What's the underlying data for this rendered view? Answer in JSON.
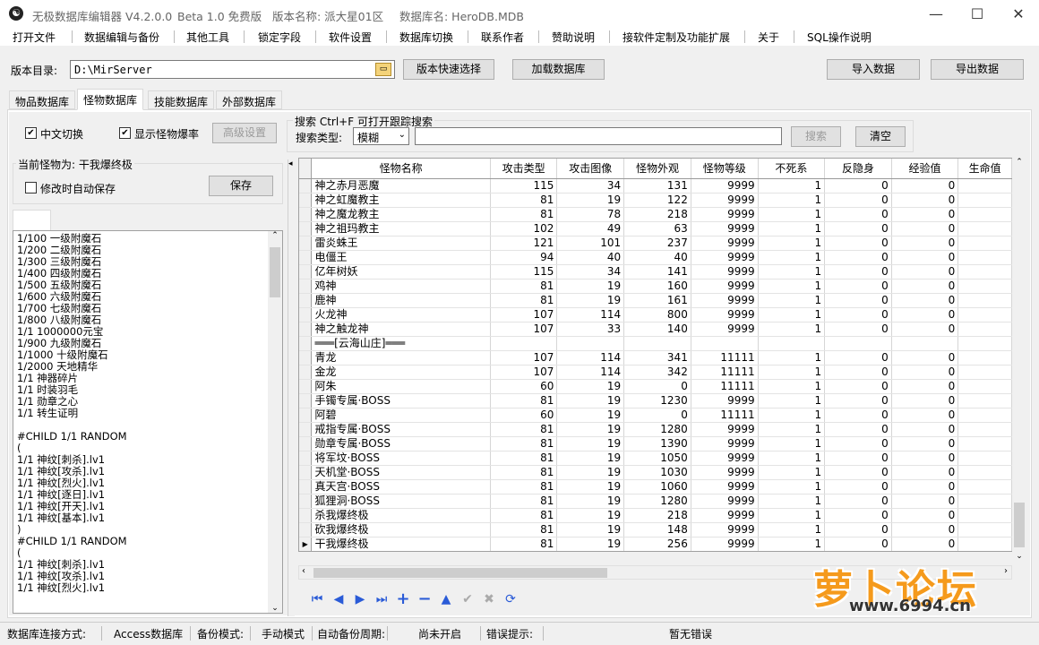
{
  "titlebar": {
    "app_name": "无极数据库编辑器 V4.2.0.0",
    "edition": "Beta 1.0 免费版",
    "version_name": "版本名称: 派大星01区",
    "db_name": "数据库名: HeroDB.MDB",
    "minimize": "—",
    "maximize": "☐",
    "close": "✕"
  },
  "menu": [
    "打开文件",
    "数据编辑与备份",
    "其他工具",
    "锁定字段",
    "软件设置",
    "数据库切换",
    "联系作者",
    "赞助说明",
    "接软件定制及功能扩展",
    "关于",
    "SQL操作说明"
  ],
  "toolbar": {
    "dir_label": "版本目录:",
    "dir_value": "D:\\MirServer",
    "quick_select": "版本快速选择",
    "load_db": "加载数据库",
    "import": "导入数据",
    "export": "导出数据"
  },
  "tabs": [
    "物品数据库",
    "怪物数据库",
    "技能数据库",
    "外部数据库"
  ],
  "options": {
    "chinese_switch": "中文切换",
    "show_drop": "显示怪物爆率",
    "advanced": "高级设置"
  },
  "search": {
    "legend": "搜索   Ctrl+F 可打开跟踪搜索",
    "type_label": "搜索类型:",
    "type_value": "模糊",
    "query": "",
    "search_btn": "搜索",
    "clear_btn": "清空"
  },
  "left_panel": {
    "current_label": "当前怪物为: 干我爆终极",
    "auto_save": "修改时自动保存",
    "save_btn": "保存",
    "drop_lines": [
      "1/100 一级附魔石",
      "1/200 二级附魔石",
      "1/300 三级附魔石",
      "1/400 四级附魔石",
      "1/500 五级附魔石",
      "1/600 六级附魔石",
      "1/700 七级附魔石",
      "1/800 八级附魔石",
      "1/1 1000000元宝",
      "1/900 九级附魔石",
      "1/1000 十级附魔石",
      "1/2000 天地精华",
      "1/1 神器碎片",
      "1/1 时装羽毛",
      "1/1 勋章之心",
      "1/1 转生证明",
      "",
      "#CHILD  1/1       RANDOM",
      "(",
      "1/1 神纹[刺杀].lv1",
      "1/1 神纹[攻杀].lv1",
      "1/1 神纹[烈火].lv1",
      "1/1 神纹[逐日].lv1",
      "1/1 神纹[开天].lv1",
      "1/1 神纹[基本].lv1",
      ")",
      "#CHILD  1/1       RANDOM",
      "(",
      "1/1 神纹[刺杀].lv1",
      "1/1 神纹[攻杀].lv1",
      "1/1 神纹[烈火].lv1"
    ]
  },
  "grid": {
    "columns": [
      "怪物名称",
      "攻击类型",
      "攻击图像",
      "怪物外观",
      "怪物等级",
      "不死系",
      "反隐身",
      "经验值",
      "生命值"
    ],
    "rows": [
      [
        "神之赤月恶魔",
        "115",
        "34",
        "131",
        "9999",
        "1",
        "0",
        "0"
      ],
      [
        "神之虹魔教主",
        "81",
        "19",
        "122",
        "9999",
        "1",
        "0",
        "0"
      ],
      [
        "神之魔龙教主",
        "81",
        "78",
        "218",
        "9999",
        "1",
        "0",
        "0"
      ],
      [
        "神之祖玛教主",
        "102",
        "49",
        "63",
        "9999",
        "1",
        "0",
        "0"
      ],
      [
        "雷炎蛛王",
        "121",
        "101",
        "237",
        "9999",
        "1",
        "0",
        "0"
      ],
      [
        "电僵王",
        "94",
        "40",
        "40",
        "9999",
        "1",
        "0",
        "0"
      ],
      [
        "亿年树妖",
        "115",
        "34",
        "141",
        "9999",
        "1",
        "0",
        "0"
      ],
      [
        "鸡神",
        "81",
        "19",
        "160",
        "9999",
        "1",
        "0",
        "0"
      ],
      [
        "鹿神",
        "81",
        "19",
        "161",
        "9999",
        "1",
        "0",
        "0"
      ],
      [
        "火龙神",
        "107",
        "114",
        "800",
        "9999",
        "1",
        "0",
        "0"
      ],
      [
        "神之触龙神",
        "107",
        "33",
        "140",
        "9999",
        "1",
        "0",
        "0"
      ],
      [
        "═══[云海山庄]═══",
        "",
        "",
        "",
        "",
        "",
        "",
        ""
      ],
      [
        "青龙",
        "107",
        "114",
        "341",
        "11111",
        "1",
        "0",
        "0"
      ],
      [
        "金龙",
        "107",
        "114",
        "342",
        "11111",
        "1",
        "0",
        "0"
      ],
      [
        "阿朱",
        "60",
        "19",
        "0",
        "11111",
        "1",
        "0",
        "0"
      ],
      [
        "手镯专属·BOSS",
        "81",
        "19",
        "1230",
        "9999",
        "1",
        "0",
        "0"
      ],
      [
        "阿碧",
        "60",
        "19",
        "0",
        "11111",
        "1",
        "0",
        "0"
      ],
      [
        "戒指专属·BOSS",
        "81",
        "19",
        "1280",
        "9999",
        "1",
        "0",
        "0"
      ],
      [
        "勋章专属·BOSS",
        "81",
        "19",
        "1390",
        "9999",
        "1",
        "0",
        "0"
      ],
      [
        "将军坟·BOSS",
        "81",
        "19",
        "1050",
        "9999",
        "1",
        "0",
        "0"
      ],
      [
        "天机堂·BOSS",
        "81",
        "19",
        "1030",
        "9999",
        "1",
        "0",
        "0"
      ],
      [
        "真天宫·BOSS",
        "81",
        "19",
        "1060",
        "9999",
        "1",
        "0",
        "0"
      ],
      [
        "狐狸洞·BOSS",
        "81",
        "19",
        "1280",
        "9999",
        "1",
        "0",
        "0"
      ],
      [
        "杀我爆终极",
        "81",
        "19",
        "218",
        "9999",
        "1",
        "0",
        "0"
      ],
      [
        "砍我爆终极",
        "81",
        "19",
        "148",
        "9999",
        "1",
        "0",
        "0"
      ],
      [
        "干我爆终极",
        "81",
        "19",
        "256",
        "9999",
        "1",
        "0",
        "0"
      ]
    ],
    "current_row_marker": "▶"
  },
  "navigator": [
    "⏮",
    "◀",
    "▶",
    "⏭",
    "+",
    "−",
    "▲",
    "✔",
    "✖",
    "⟳"
  ],
  "status": {
    "conn_label": "数据库连接方式:",
    "conn_value": "Access数据库",
    "backup_label": "备份模式:",
    "backup_value": "手动模式",
    "auto_label": "自动备份周期:",
    "auto_value": "尚未开启",
    "err_label": "错误提示:",
    "err_value": "暂无错误"
  },
  "watermark": {
    "brand": "萝卜论坛",
    "url": "www.6994.cn"
  },
  "colors": {
    "accent": "#0078d7",
    "nav_icon": "#2a5bd7",
    "watermark": "#f59a1c"
  }
}
